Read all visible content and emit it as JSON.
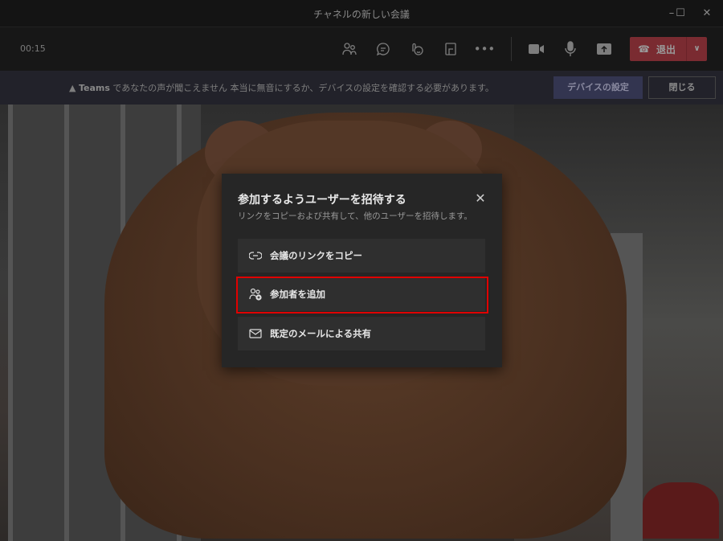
{
  "window": {
    "title": "チャネルの新しい会議",
    "minimize": "–",
    "maximize": "☐",
    "close": "✕"
  },
  "toolbar": {
    "timer": "00:15",
    "leave_label": "退出"
  },
  "banner": {
    "app": "Teams",
    "message": " であなたの声が聞こえません  本当に無音にするか、デバイスの設定を確認する必要があります。",
    "device_settings": "デバイスの設定",
    "close": "閉じる"
  },
  "dialog": {
    "title": "参加するようユーザーを招待する",
    "subtitle": "リンクをコピーおよび共有して、他のユーザーを招待します。",
    "close": "✕",
    "options": [
      {
        "label": "会議のリンクをコピー",
        "icon": "link-icon"
      },
      {
        "label": "参加者を追加",
        "icon": "add-people-icon",
        "highlighted": true
      },
      {
        "label": "既定のメールによる共有",
        "icon": "mail-icon"
      }
    ]
  },
  "colors": {
    "highlight": "#e00000",
    "leave": "#7a2b31"
  }
}
